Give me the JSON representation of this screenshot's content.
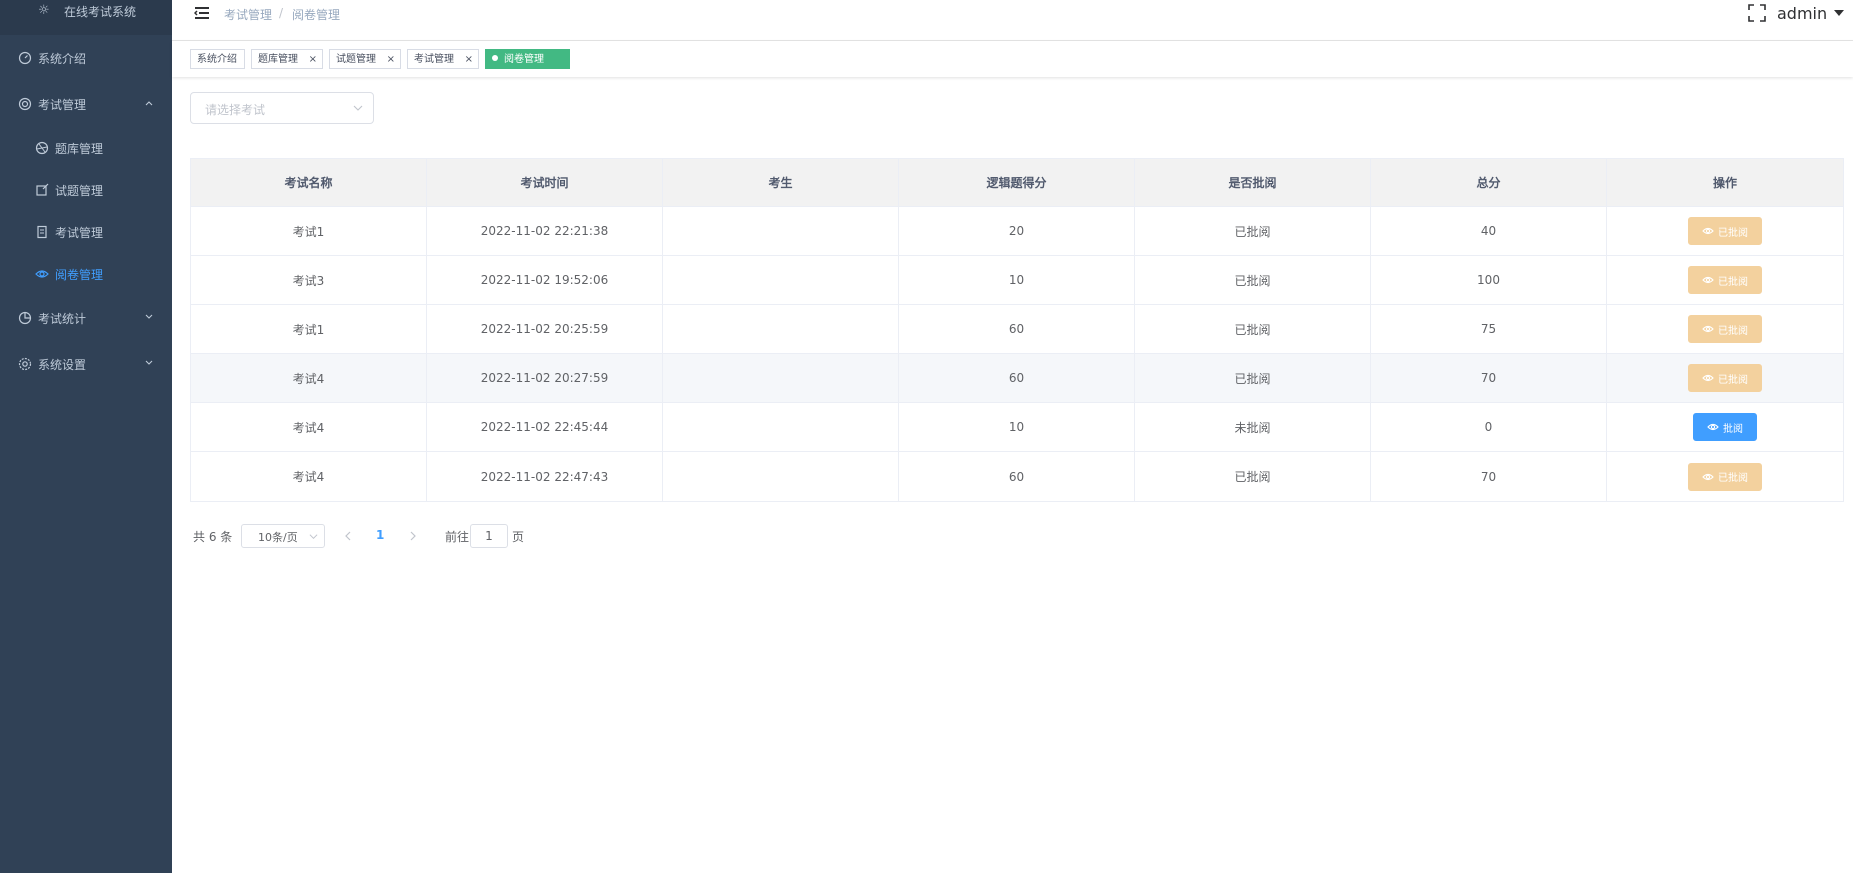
{
  "sidebar": {
    "logo_title": "在线考试系统",
    "menu": [
      {
        "label": "系统介绍",
        "icon": "dashboard-icon"
      },
      {
        "label": "考试管理",
        "icon": "lifebuoy-icon",
        "expanded": true
      },
      {
        "label": "考试统计",
        "icon": "pie-chart-icon",
        "expanded": false
      },
      {
        "label": "系统设置",
        "icon": "gear-icon",
        "expanded": false
      }
    ],
    "submenu": [
      {
        "label": "题库管理",
        "icon": "aperture-icon"
      },
      {
        "label": "试题管理",
        "icon": "edit-icon"
      },
      {
        "label": "考试管理",
        "icon": "document-icon"
      },
      {
        "label": "阅卷管理",
        "icon": "eye-icon",
        "active": true
      }
    ],
    "active_color": "#409eff"
  },
  "navbar": {
    "breadcrumb": [
      "考试管理",
      "阅卷管理"
    ],
    "breadcrumb_separator": "/",
    "user": "admin"
  },
  "tags": [
    {
      "label": "系统介绍",
      "closable": false
    },
    {
      "label": "题库管理",
      "closable": true
    },
    {
      "label": "试题管理",
      "closable": true
    },
    {
      "label": "考试管理",
      "closable": true
    },
    {
      "label": "阅卷管理",
      "closable": false,
      "active": true
    }
  ],
  "tag_close_glyph": "×",
  "tag_active_color": "#42b983",
  "filter": {
    "exam_placeholder": "请选择考试"
  },
  "table": {
    "columns": [
      "考试名称",
      "考试时间",
      "考生",
      "逻辑题得分",
      "是否批阅",
      "总分",
      "操作"
    ],
    "rows": [
      {
        "name": "考试1",
        "time": "2022-11-02 22:21:38",
        "student": "",
        "logic_score": "20",
        "reviewed": "已批阅",
        "total": "40",
        "action": "已批阅",
        "action_type": "done"
      },
      {
        "name": "考试3",
        "time": "2022-11-02 19:52:06",
        "student": "",
        "logic_score": "10",
        "reviewed": "已批阅",
        "total": "100",
        "action": "已批阅",
        "action_type": "done"
      },
      {
        "name": "考试1",
        "time": "2022-11-02 20:25:59",
        "student": "",
        "logic_score": "60",
        "reviewed": "已批阅",
        "total": "75",
        "action": "已批阅",
        "action_type": "done"
      },
      {
        "name": "考试4",
        "time": "2022-11-02 20:27:59",
        "student": "",
        "logic_score": "60",
        "reviewed": "已批阅",
        "total": "70",
        "action": "已批阅",
        "action_type": "done"
      },
      {
        "name": "考试4",
        "time": "2022-11-02 22:45:44",
        "student": "",
        "logic_score": "10",
        "reviewed": "未批阅",
        "total": "0",
        "action": "批阅",
        "action_type": "review"
      },
      {
        "name": "考试4",
        "time": "2022-11-02 22:47:43",
        "student": "",
        "logic_score": "60",
        "reviewed": "已批阅",
        "total": "70",
        "action": "已批阅",
        "action_type": "done"
      }
    ],
    "done_button_color": "#f3d19e",
    "review_button_color": "#409eff"
  },
  "pagination": {
    "total_label": "共 6 条",
    "page_size": "10条/页",
    "current_page": "1",
    "goto_label": "前往",
    "goto_value": "1",
    "page_suffix": "页"
  }
}
